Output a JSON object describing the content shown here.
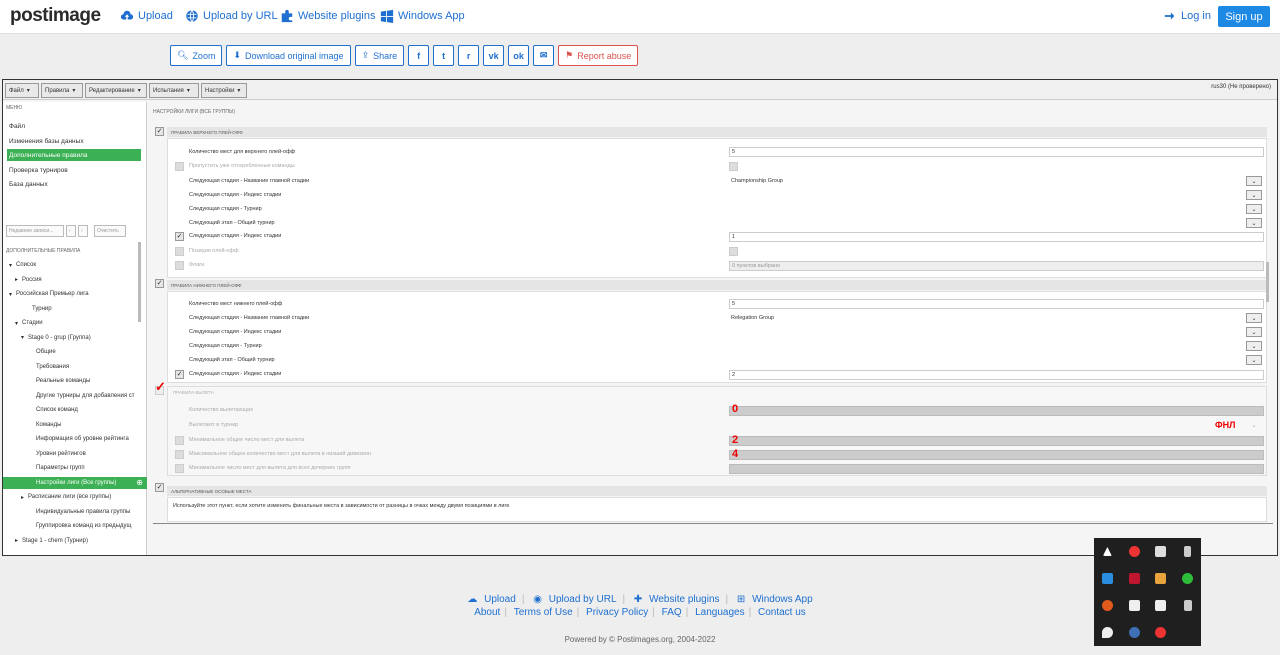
{
  "nav": {
    "logo": "postimage",
    "upload": "Upload",
    "upload_url": "Upload by URL",
    "plugins": "Website plugins",
    "windows_app": "Windows App",
    "login": "Log in",
    "signup": "Sign up"
  },
  "actions": {
    "zoom": "Zoom",
    "download": "Download original image",
    "share": "Share",
    "report": "Report abuse",
    "social": [
      "f",
      "t",
      "r",
      "vk",
      "ok",
      "✉"
    ]
  },
  "screenshot": {
    "menubar": [
      "Файл",
      "Правила",
      "Редактирование",
      "Испытания",
      "Настройки"
    ],
    "user": "rus30 (Не проверено)",
    "sidebar_title": "МЕНЮ",
    "menu": [
      "Файл",
      "Изменения базы данных",
      "Дополнительные правила",
      "Проверка турниров",
      "База данных"
    ],
    "search_placeholder": "Недавние записи...",
    "clear": "Очистить",
    "rules_title": "ДОПОЛНИТЕЛЬНЫЕ ПРАВИЛА",
    "tree": [
      {
        "label": "Список",
        "arr": "▾"
      },
      {
        "label": "Россия",
        "arr": "▸"
      },
      {
        "label": "Российская Премьер лига",
        "arr": "▾"
      },
      {
        "label": "Турнир",
        "arr": ""
      },
      {
        "label": "Стадии",
        "arr": "▾"
      },
      {
        "label": "Stage 0 - grup (Группа)",
        "arr": "▾"
      },
      {
        "label": "Общие",
        "arr": ""
      },
      {
        "label": "Требования",
        "arr": ""
      },
      {
        "label": "Реальные команды",
        "arr": ""
      },
      {
        "label": "Другие турниры для добавления ст",
        "arr": ""
      },
      {
        "label": "Список команд",
        "arr": ""
      },
      {
        "label": "Команды",
        "arr": ""
      },
      {
        "label": "Информация об уровне рейтинга",
        "arr": ""
      },
      {
        "label": "Уровни рейтингов",
        "arr": ""
      },
      {
        "label": "Параметры групп",
        "arr": ""
      },
      {
        "label": "Настройки лиги (Все группы)",
        "arr": ""
      },
      {
        "label": "Расписание лиги (все группы)",
        "arr": "▸"
      },
      {
        "label": "Индивидуальные правила группы",
        "arr": ""
      },
      {
        "label": "Группировка команд из предыдущ",
        "arr": ""
      },
      {
        "label": "Stage 1 - chem (Турнир)",
        "arr": "▸"
      }
    ],
    "main_title": "НАСТРОЙКИ ЛИГИ (ВСЕ ГРУППЫ)",
    "upper_header": "ПРАВИЛА ВЕРХНЕГО ПЛЕЙ-ОФФ",
    "upper_rows": [
      {
        "label": "Количество мест для верхнего плей-офф",
        "value": "5"
      },
      {
        "label": "Пропустить уже отсеребленные команды",
        "value": ""
      },
      {
        "label": "Следующая стадия - Название главной стадии",
        "value": "Championship Group"
      },
      {
        "label": "Следующая стадия - Индекс стадии",
        "value": ""
      },
      {
        "label": "Следующая стадия - Турнир",
        "value": ""
      },
      {
        "label": "Следующий этап - Общий турнир",
        "value": ""
      },
      {
        "label": "Следующая стадия - Индекс стадии",
        "value": "1"
      },
      {
        "label": "Позиция плей-офф",
        "value": ""
      },
      {
        "label": "Флаги",
        "value": "0 пунктов выбрано"
      }
    ],
    "lower_header": "ПРАВИЛА НИЖНЕГО ПЛЕЙ-ОФФ",
    "lower_rows": [
      {
        "label": "Количество мест нижнего плей-офф",
        "value": "5"
      },
      {
        "label": "Следующая стадия - Название главной стадии",
        "value": "Relegation Group"
      },
      {
        "label": "Следующая стадия - Индекс стадии",
        "value": ""
      },
      {
        "label": "Следующая стадия - Турнир",
        "value": ""
      },
      {
        "label": "Следующий этап - Общий турнир",
        "value": ""
      },
      {
        "label": "Следующая стадия - Индекс стадии",
        "value": "2"
      }
    ],
    "relegation_header": "ПРАВИЛА ВЫЛЕТА",
    "relegation_rows": [
      {
        "label": "Количество вылетающих"
      },
      {
        "label": "Вылетают в турнир"
      },
      {
        "label": "Минимальное общее число мест для вылета"
      },
      {
        "label": "Максимальное общее количество мест для вылета в низший дивизион"
      },
      {
        "label": "Минимальное число мест для вылета для всех дочерних групп"
      }
    ],
    "annotations": {
      "a0": "0",
      "fnl": "ФНЛ",
      "a2": "2",
      "a4": "4"
    },
    "alt_header": "АЛЬТЕРНАТИВНЫЕ ОСОБЫЕ МЕСТА",
    "alt_text": "Используйте этот пункт, если хотите изменить финальные места в зависимости от разницы в очках между двумя позициями в лиге"
  },
  "footer": {
    "upload": "Upload",
    "upload_url": "Upload by URL",
    "plugins": "Website plugins",
    "windows_app": "Windows App",
    "about": "About",
    "terms": "Terms of Use",
    "privacy": "Privacy Policy",
    "faq": "FAQ",
    "languages": "Languages",
    "contact": "Contact us",
    "copyright": "Powered by © Postimages.org, 2004-2022"
  },
  "colors": {
    "accent": "#1e6fd0",
    "green": "#3cb054",
    "annot": "#e00000"
  }
}
